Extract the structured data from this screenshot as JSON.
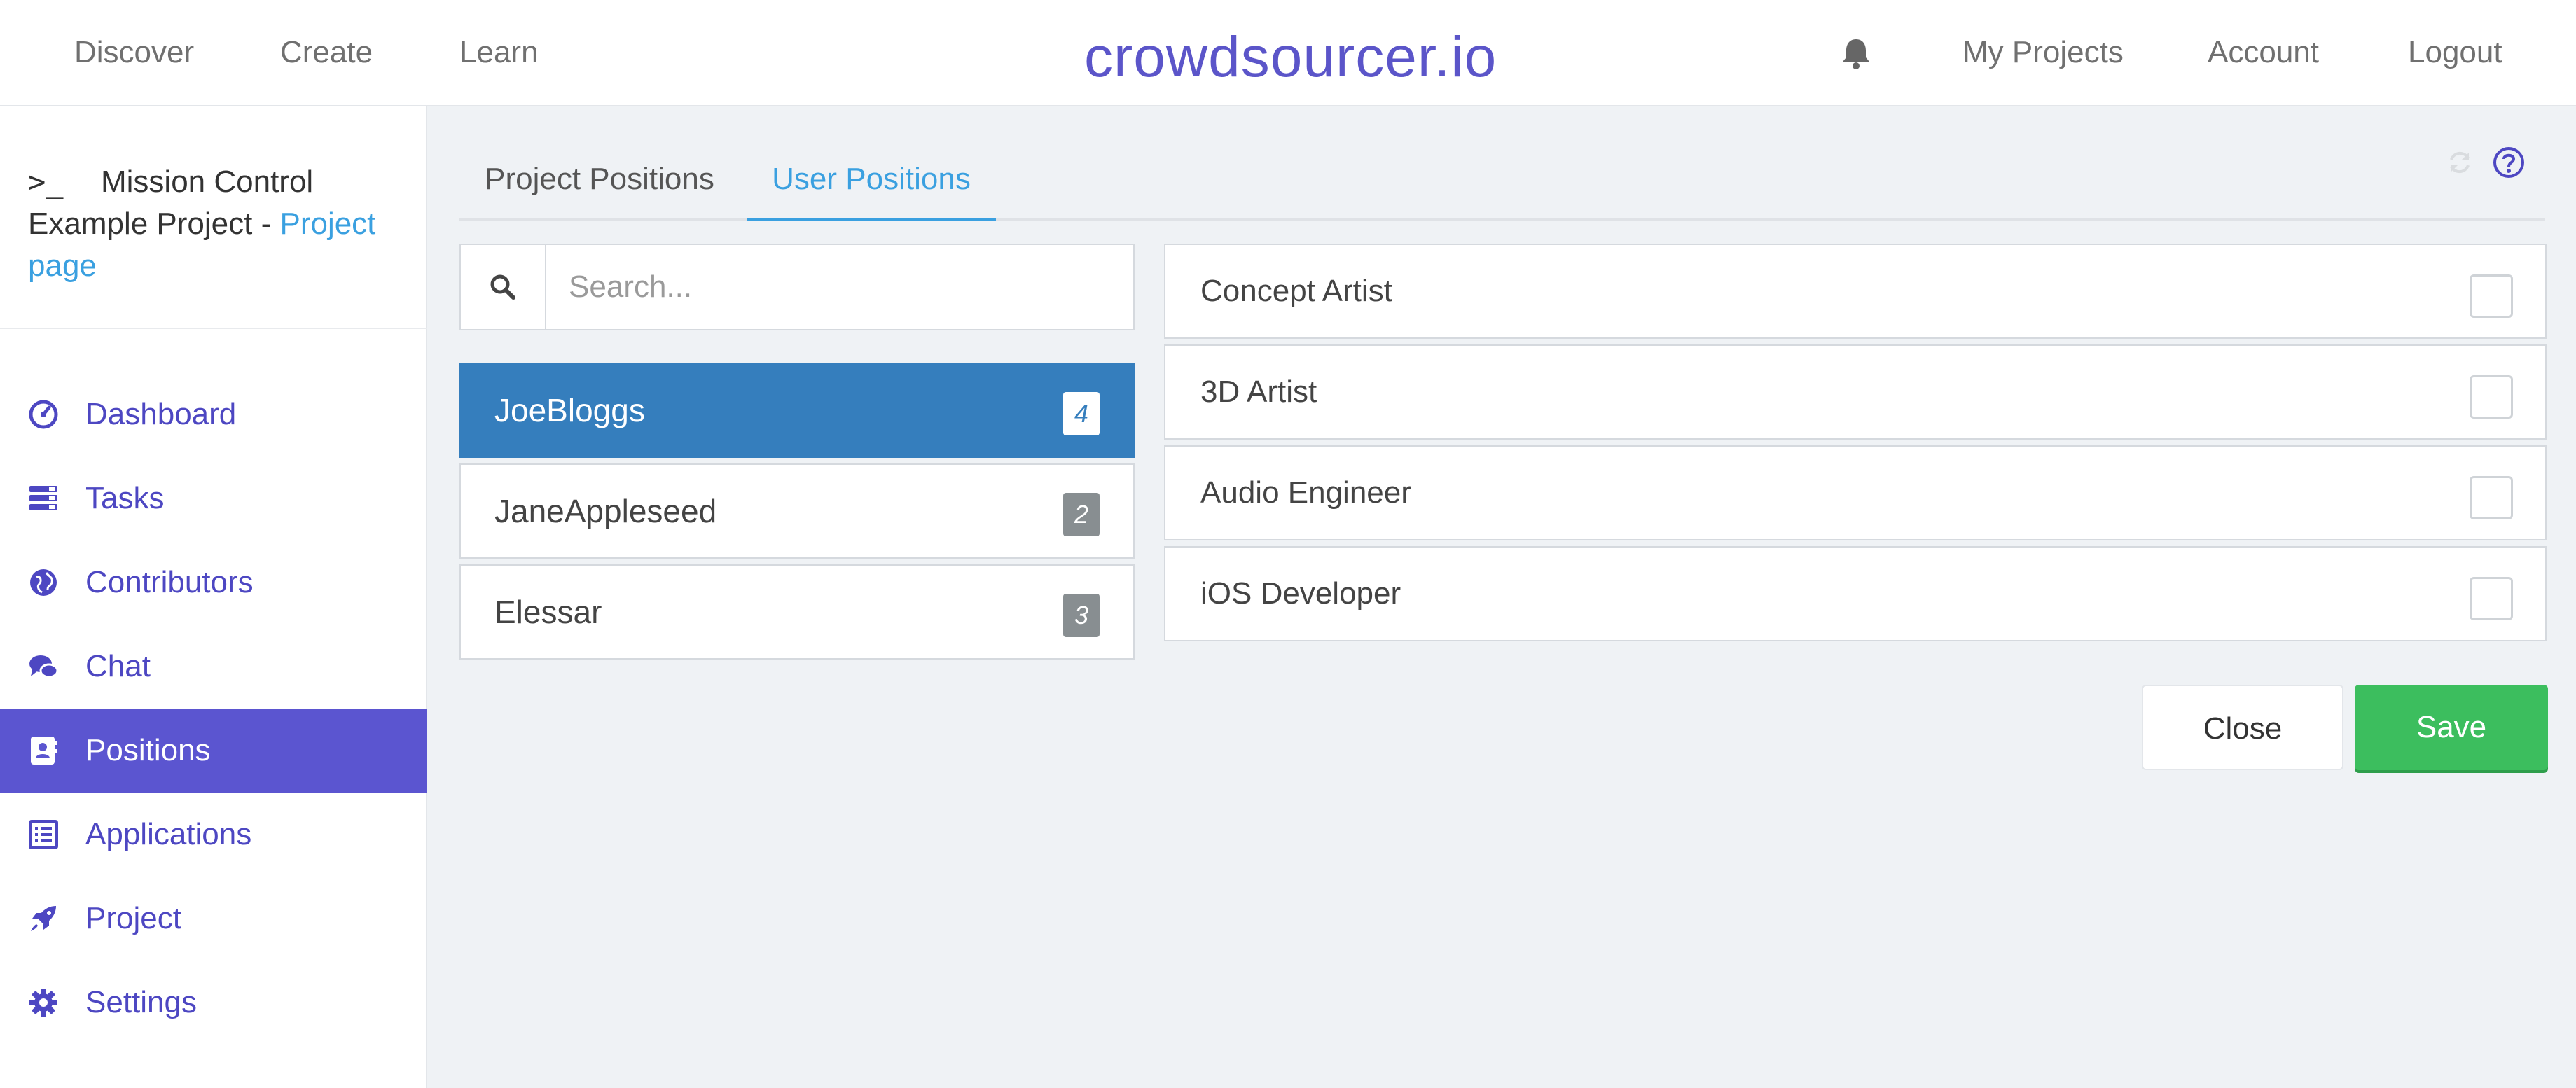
{
  "topbar": {
    "nav": [
      "Discover",
      "Create",
      "Learn"
    ],
    "brand": "crowdsourcer.io",
    "right": [
      "My Projects",
      "Account",
      "Logout"
    ]
  },
  "sidebar": {
    "project_title": "Mission Control Example Project - ",
    "project_link": "Project page",
    "items": [
      {
        "label": "Dashboard",
        "icon": "dashboard-icon"
      },
      {
        "label": "Tasks",
        "icon": "tasks-icon"
      },
      {
        "label": "Contributors",
        "icon": "globe-icon"
      },
      {
        "label": "Chat",
        "icon": "chat-icon"
      },
      {
        "label": "Positions",
        "icon": "contact-card-icon",
        "active": true
      },
      {
        "label": "Applications",
        "icon": "list-icon"
      },
      {
        "label": "Project",
        "icon": "rocket-icon"
      },
      {
        "label": "Settings",
        "icon": "gear-icon"
      }
    ]
  },
  "main": {
    "tabs": [
      {
        "label": "Project Positions",
        "active": false
      },
      {
        "label": "User Positions",
        "active": true
      }
    ],
    "search": {
      "placeholder": "Search...",
      "value": ""
    },
    "users": [
      {
        "name": "JoeBloggs",
        "count": "4",
        "active": true
      },
      {
        "name": "JaneAppleseed",
        "count": "2",
        "active": false
      },
      {
        "name": "Elessar",
        "count": "3",
        "active": false
      }
    ],
    "positions": [
      {
        "name": "Concept Artist",
        "checked": false
      },
      {
        "name": "3D Artist",
        "checked": false
      },
      {
        "name": "Audio Engineer",
        "checked": false
      },
      {
        "name": "iOS Developer",
        "checked": false
      }
    ],
    "close_label": "Close",
    "save_label": "Save"
  },
  "colors": {
    "brand": "#5b55c9",
    "accent_blue": "#3aa0e0",
    "active_user": "#357ebd",
    "sidebar_active": "#5b55d0",
    "save_green": "#3cbe5e"
  }
}
